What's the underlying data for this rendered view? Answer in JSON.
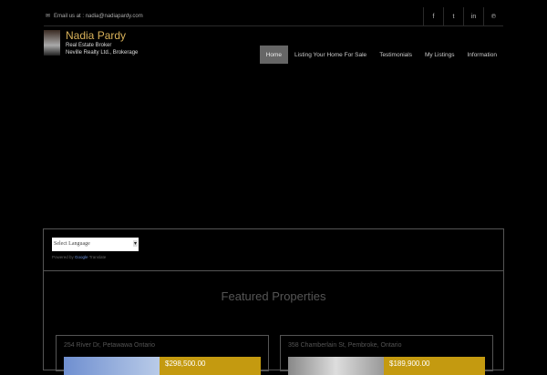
{
  "top": {
    "email_label": "Email us at : nadia@nadiapardy.com",
    "social": [
      {
        "icon": "facebook-icon",
        "glyph": "f"
      },
      {
        "icon": "twitter-icon",
        "glyph": "t"
      },
      {
        "icon": "linkedin-icon",
        "glyph": "in"
      },
      {
        "icon": "pinterest-icon",
        "glyph": "℗"
      }
    ]
  },
  "brand": {
    "name": "Nadia Pardy",
    "title": "Real Estate Broker",
    "company": "Neville Realty Ltd., Brokerage"
  },
  "nav": [
    "Home",
    "Listing Your Home For Sale",
    "Testimonials",
    "My Listings",
    "Information"
  ],
  "translate": {
    "select": "Select Language",
    "powered": "Powered by",
    "google": "Google",
    "translate": "Translate"
  },
  "featured": {
    "title": "Featured Properties",
    "cards": [
      {
        "address": "254 River Dr, Petawawa Ontario",
        "price": "$298,500.00"
      },
      {
        "address": "358 Chamberlain St, Pembroke, Ontario",
        "price": "$189,900.00"
      }
    ]
  },
  "colors": {
    "accent": "#d9b25a",
    "price_bg": "#c49a10"
  }
}
